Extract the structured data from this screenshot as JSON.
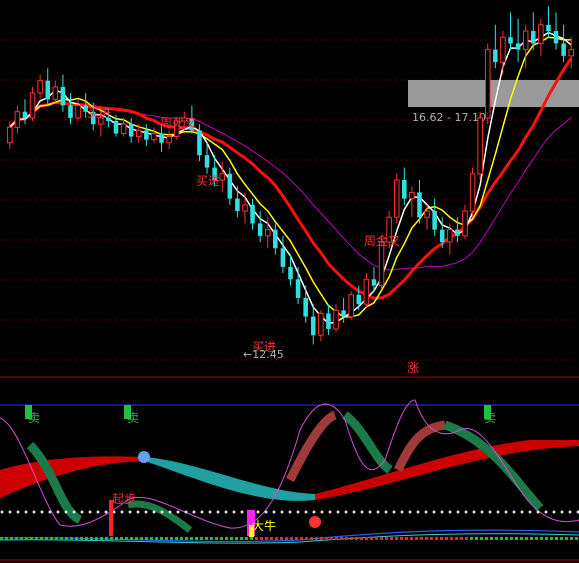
{
  "chart_data": [
    {
      "type": "candlestick",
      "panel": "main",
      "price_range_label": "16.62 - 17.10",
      "low_marker": "←12.45",
      "annotations": [
        {
          "text": "买进",
          "color": "#ff3030"
        },
        {
          "text": "周死叉",
          "color": "#ff3030"
        },
        {
          "text": "买进",
          "color": "#ff3030"
        },
        {
          "text": "买进",
          "color": "#ff3030"
        },
        {
          "text": "周金叉",
          "color": "#ff3030"
        }
      ],
      "ohlc": [
        [
          0,
          15.7,
          16.05,
          15.6,
          15.95
        ],
        [
          1,
          15.95,
          16.3,
          15.85,
          16.2
        ],
        [
          2,
          16.2,
          16.4,
          16.0,
          16.1
        ],
        [
          3,
          16.1,
          16.6,
          16.05,
          16.5
        ],
        [
          4,
          16.5,
          16.8,
          16.4,
          16.7
        ],
        [
          5,
          16.7,
          16.9,
          16.3,
          16.4
        ],
        [
          6,
          16.4,
          16.7,
          16.35,
          16.6
        ],
        [
          7,
          16.6,
          16.8,
          16.2,
          16.3
        ],
        [
          8,
          16.3,
          16.5,
          16.0,
          16.1
        ],
        [
          9,
          16.1,
          16.4,
          16.05,
          16.3
        ],
        [
          10,
          16.3,
          16.5,
          16.1,
          16.2
        ],
        [
          11,
          16.2,
          16.35,
          15.9,
          16.0
        ],
        [
          12,
          16.0,
          16.2,
          15.8,
          16.1
        ],
        [
          13,
          16.1,
          16.25,
          15.95,
          16.05
        ],
        [
          14,
          16.05,
          16.15,
          15.8,
          15.85
        ],
        [
          15,
          15.85,
          16.1,
          15.8,
          16.0
        ],
        [
          16,
          16.0,
          16.1,
          15.7,
          15.8
        ],
        [
          17,
          15.8,
          16.0,
          15.7,
          15.9
        ],
        [
          18,
          15.9,
          16.0,
          15.65,
          15.75
        ],
        [
          19,
          15.75,
          15.95,
          15.7,
          15.85
        ],
        [
          20,
          15.85,
          16.0,
          15.55,
          15.7
        ],
        [
          21,
          15.7,
          15.9,
          15.6,
          15.8
        ],
        [
          22,
          15.8,
          16.1,
          15.75,
          16.05
        ],
        [
          23,
          16.05,
          16.2,
          15.9,
          16.1
        ],
        [
          24,
          16.1,
          16.3,
          15.85,
          15.9
        ],
        [
          25,
          15.9,
          16.0,
          15.4,
          15.5
        ],
        [
          26,
          15.5,
          15.7,
          15.2,
          15.3
        ],
        [
          27,
          15.3,
          15.5,
          15.0,
          15.1
        ],
        [
          28,
          15.1,
          15.4,
          14.9,
          15.2
        ],
        [
          29,
          15.2,
          15.3,
          14.7,
          14.8
        ],
        [
          30,
          14.8,
          15.0,
          14.5,
          14.6
        ],
        [
          31,
          14.6,
          14.9,
          14.4,
          14.7
        ],
        [
          32,
          14.7,
          14.8,
          14.3,
          14.4
        ],
        [
          33,
          14.4,
          14.6,
          14.1,
          14.2
        ],
        [
          34,
          14.2,
          14.5,
          14.0,
          14.3
        ],
        [
          35,
          14.3,
          14.4,
          13.9,
          14.0
        ],
        [
          36,
          14.0,
          14.2,
          13.6,
          13.7
        ],
        [
          37,
          13.7,
          13.9,
          13.4,
          13.5
        ],
        [
          38,
          13.5,
          13.7,
          13.1,
          13.2
        ],
        [
          39,
          13.2,
          13.4,
          12.8,
          12.9
        ],
        [
          40,
          12.9,
          13.1,
          12.45,
          12.6
        ],
        [
          41,
          12.6,
          13.0,
          12.5,
          12.95
        ],
        [
          42,
          12.95,
          13.1,
          12.6,
          12.7
        ],
        [
          43,
          12.7,
          13.1,
          12.65,
          13.0
        ],
        [
          44,
          13.0,
          13.2,
          12.8,
          12.9
        ],
        [
          45,
          12.9,
          13.3,
          12.85,
          13.25
        ],
        [
          46,
          13.25,
          13.4,
          13.0,
          13.1
        ],
        [
          47,
          13.1,
          13.6,
          13.05,
          13.5
        ],
        [
          48,
          13.5,
          13.7,
          13.3,
          13.4
        ],
        [
          49,
          13.4,
          14.2,
          13.35,
          14.1
        ],
        [
          50,
          14.1,
          14.6,
          14.0,
          14.5
        ],
        [
          51,
          14.5,
          15.2,
          14.4,
          15.1
        ],
        [
          52,
          15.1,
          15.3,
          14.7,
          14.8
        ],
        [
          53,
          14.8,
          15.0,
          14.5,
          14.9
        ],
        [
          54,
          14.9,
          15.1,
          14.4,
          14.5
        ],
        [
          55,
          14.5,
          14.7,
          14.3,
          14.6
        ],
        [
          56,
          14.6,
          14.8,
          14.2,
          14.3
        ],
        [
          57,
          14.3,
          14.5,
          14.0,
          14.1
        ],
        [
          58,
          14.1,
          14.4,
          13.9,
          14.3
        ],
        [
          59,
          14.3,
          14.5,
          14.1,
          14.2
        ],
        [
          60,
          14.2,
          14.7,
          14.15,
          14.6
        ],
        [
          61,
          14.6,
          15.3,
          14.5,
          15.2
        ],
        [
          62,
          15.2,
          16.2,
          15.1,
          16.1
        ],
        [
          63,
          16.1,
          17.3,
          16.0,
          17.2
        ],
        [
          64,
          17.2,
          17.6,
          16.9,
          17.0
        ],
        [
          65,
          17.0,
          17.5,
          16.8,
          17.4
        ],
        [
          66,
          17.4,
          17.8,
          17.2,
          17.3
        ],
        [
          67,
          17.3,
          17.7,
          17.0,
          17.2
        ],
        [
          68,
          17.2,
          17.6,
          16.9,
          17.5
        ],
        [
          69,
          17.5,
          17.8,
          17.2,
          17.3
        ],
        [
          70,
          17.3,
          17.7,
          17.1,
          17.6
        ],
        [
          71,
          17.6,
          17.9,
          17.4,
          17.5
        ],
        [
          72,
          17.5,
          17.8,
          17.2,
          17.3
        ],
        [
          73,
          17.3,
          17.6,
          17.0,
          17.1
        ],
        [
          74,
          17.1,
          17.4,
          16.9,
          17.2
        ]
      ]
    },
    {
      "type": "indicator",
      "panel": "sub",
      "labels": [
        {
          "text": "涨",
          "color": "#ff3030"
        },
        {
          "text": "卖",
          "color": "#20c040"
        },
        {
          "text": "卖",
          "color": "#20c040"
        },
        {
          "text": "卖",
          "color": "#20c040"
        },
        {
          "text": "起步",
          "color": "#ff3030"
        },
        {
          "text": "大牛",
          "color": "#ffff00"
        }
      ]
    }
  ]
}
